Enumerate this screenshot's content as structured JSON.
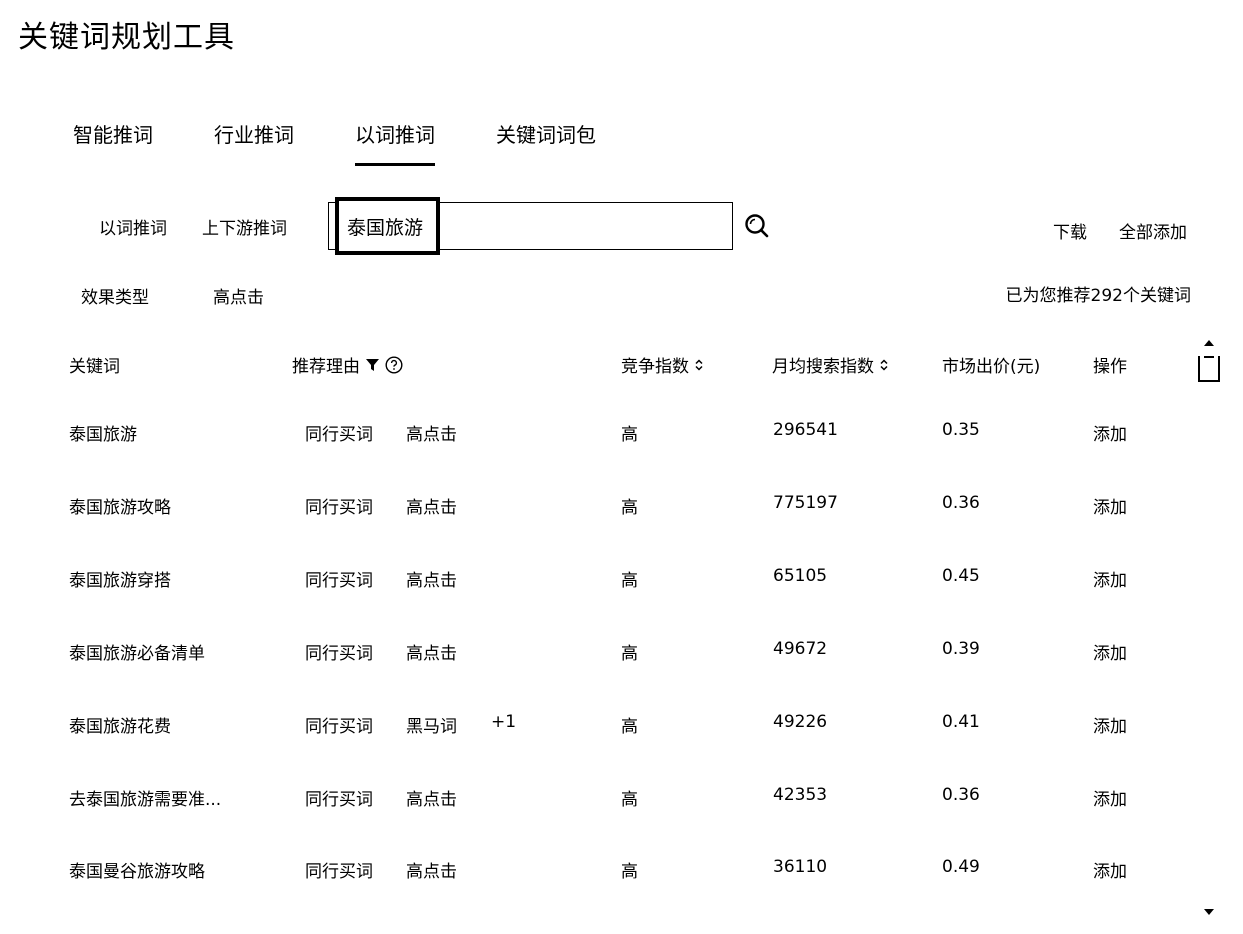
{
  "app": {
    "title": "关键词规划工具"
  },
  "main_tabs": [
    {
      "label": "智能推词",
      "active": false
    },
    {
      "label": "行业推词",
      "active": false
    },
    {
      "label": "以词推词",
      "active": true
    },
    {
      "label": "关键词词包",
      "active": false
    }
  ],
  "sub_tabs": [
    {
      "label": "以词推词"
    },
    {
      "label": "上下游推词"
    }
  ],
  "search": {
    "value": "泰国旅游",
    "placeholder": ""
  },
  "actions": {
    "download": "下载",
    "add_all": "全部添加"
  },
  "filter": {
    "label": "效果类型",
    "value": "高点击"
  },
  "summary": "已为您推荐292个关键词",
  "table": {
    "headers": {
      "keyword": "关键词",
      "reason": "推荐理由",
      "competition": "竞争指数",
      "monthly_search": "月均搜索指数",
      "market_bid": "市场出价(元)",
      "operation": "操作"
    },
    "rows": [
      {
        "keyword": "泰国旅游",
        "tag1": "同行买词",
        "tag2": "高点击",
        "extra": "",
        "competition": "高",
        "monthly_search": "296541",
        "bid": "0.35",
        "action": "添加"
      },
      {
        "keyword": "泰国旅游攻略",
        "tag1": "同行买词",
        "tag2": "高点击",
        "extra": "",
        "competition": "高",
        "monthly_search": "775197",
        "bid": "0.36",
        "action": "添加"
      },
      {
        "keyword": "泰国旅游穿搭",
        "tag1": "同行买词",
        "tag2": "高点击",
        "extra": "",
        "competition": "高",
        "monthly_search": "65105",
        "bid": "0.45",
        "action": "添加"
      },
      {
        "keyword": "泰国旅游必备清单",
        "tag1": "同行买词",
        "tag2": "高点击",
        "extra": "",
        "competition": "高",
        "monthly_search": "49672",
        "bid": "0.39",
        "action": "添加"
      },
      {
        "keyword": "泰国旅游花费",
        "tag1": "同行买词",
        "tag2": "黑马词",
        "extra": "+1",
        "competition": "高",
        "monthly_search": "49226",
        "bid": "0.41",
        "action": "添加"
      },
      {
        "keyword": "去泰国旅游需要准...",
        "tag1": "同行买词",
        "tag2": "高点击",
        "extra": "",
        "competition": "高",
        "monthly_search": "42353",
        "bid": "0.36",
        "action": "添加"
      },
      {
        "keyword": "泰国曼谷旅游攻略",
        "tag1": "同行买词",
        "tag2": "高点击",
        "extra": "",
        "competition": "高",
        "monthly_search": "36110",
        "bid": "0.49",
        "action": "添加"
      }
    ]
  },
  "icons": {
    "search": "search-icon",
    "filter": "filter-icon",
    "help": "help-circle-icon",
    "sort": "sort-icon"
  }
}
